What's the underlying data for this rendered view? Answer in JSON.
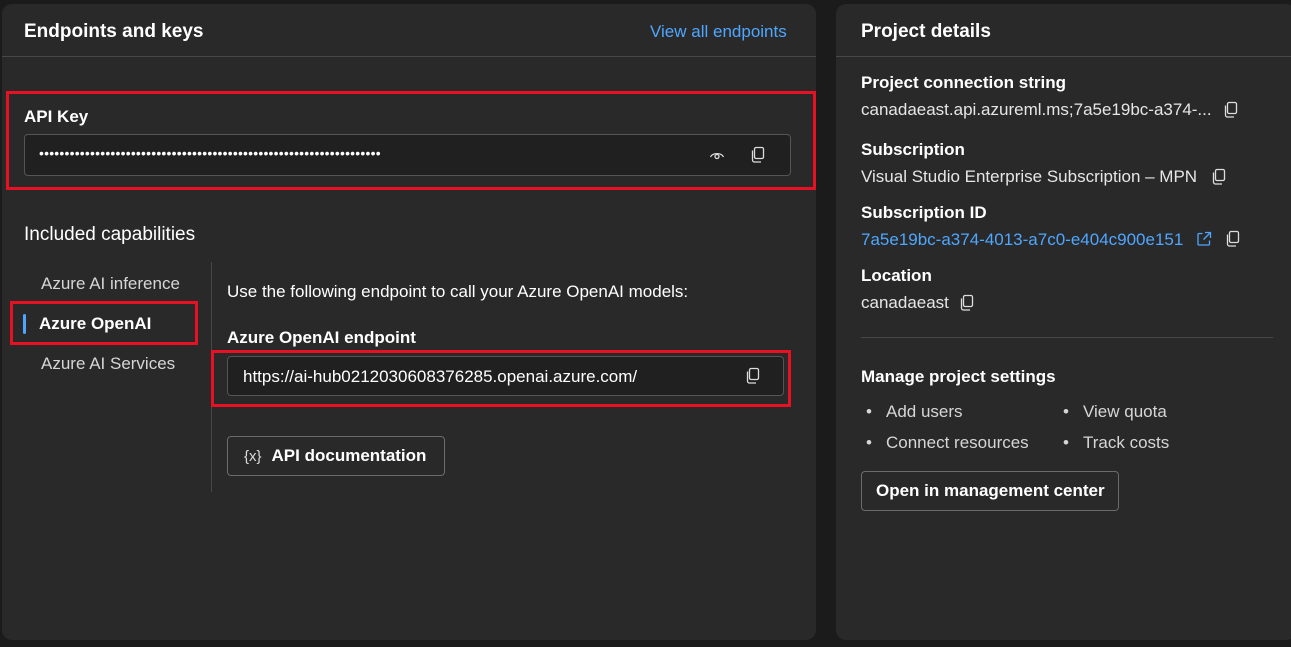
{
  "endpoints": {
    "title": "Endpoints and keys",
    "view_all_link": "View all endpoints",
    "api_key_label": "API Key",
    "api_key_masked": "•••••••••••••••••••••••••••••••••••••••••••••••••••••••••••••••••••",
    "included_capabilities_title": "Included capabilities",
    "capabilities": [
      {
        "label": "Azure AI inference",
        "selected": false
      },
      {
        "label": "Azure OpenAI",
        "selected": true
      },
      {
        "label": "Azure AI Services",
        "selected": false
      }
    ],
    "endpoint_intro": "Use the following endpoint to call your Azure OpenAI models:",
    "endpoint_label": "Azure OpenAI endpoint",
    "endpoint_value": "https://ai-hub0212030608376285.openai.azure.com/",
    "api_doc_icon": "{x}",
    "api_doc_button": "API documentation"
  },
  "project": {
    "title": "Project details",
    "connection_string_label": "Project connection string",
    "connection_string_value": "canadaeast.api.azureml.ms;7a5e19bc-a374-...",
    "subscription_label": "Subscription",
    "subscription_value": "Visual Studio Enterprise Subscription – MPN",
    "subscription_id_label": "Subscription ID",
    "subscription_id_value": "7a5e19bc-a374-4013-a7c0-e404c900e151",
    "location_label": "Location",
    "location_value": "canadaeast",
    "manage_title": "Manage project settings",
    "manage_links": [
      "Add users",
      "View quota",
      "Connect resources",
      "Track costs"
    ],
    "open_center_button": "Open in management center"
  },
  "colors": {
    "accent_link": "#4fa6ff",
    "highlight": "#e81123",
    "selected_indicator": "#4fa6ff"
  },
  "icons": [
    "eye-icon",
    "copy-icon",
    "external-link-icon",
    "variable-icon"
  ]
}
